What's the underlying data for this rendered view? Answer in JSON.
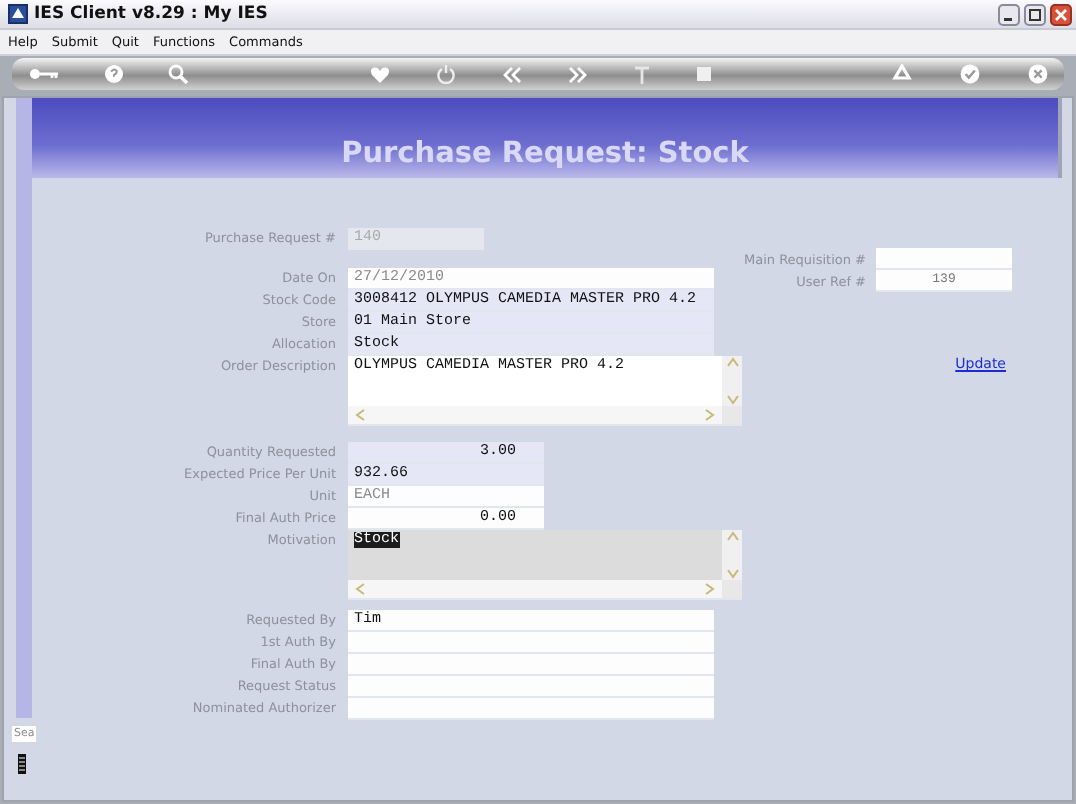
{
  "window": {
    "title": "IES Client v8.29 : My IES"
  },
  "menu": [
    "Help",
    "Submit",
    "Quit",
    "Functions",
    "Commands"
  ],
  "page_title": "Purchase Request: Stock",
  "request_number": {
    "label": "Purchase Request #",
    "value": "140"
  },
  "references": [
    {
      "label": "Main Requisition #"
    },
    {
      "label": "User Ref #",
      "value": "139"
    }
  ],
  "update_link": "Update",
  "detail_fields": [
    {
      "label": "Date On",
      "value": "27/12/2010",
      "kind": "line",
      "required": false,
      "disabled": true
    },
    {
      "label": "Stock Code",
      "value": "3008412 OLYMPUS CAMEDIA MASTER PRO 4.2",
      "kind": "line",
      "required": true,
      "disabled": false
    },
    {
      "label": "Store",
      "value": "01 Main Store",
      "kind": "line",
      "required": true,
      "disabled": false
    },
    {
      "label": "Allocation",
      "value": "Stock",
      "kind": "line",
      "required": true,
      "disabled": false
    },
    {
      "label": "Order Description",
      "value": "OLYMPUS CAMEDIA MASTER PRO 4.2",
      "kind": "memo",
      "required": false,
      "disabled": false
    }
  ],
  "amount_fields": [
    {
      "label": "Quantity Requested",
      "value": "3.00",
      "kind": "number",
      "required": true,
      "disabled": false
    },
    {
      "label": "Expected Price Per Unit",
      "value": "932.66",
      "kind": "line",
      "required": true,
      "disabled": false
    },
    {
      "label": "Unit",
      "value": "EACH",
      "kind": "line",
      "required": false,
      "disabled": true
    },
    {
      "label": "Final Auth Price",
      "value": "0.00",
      "kind": "number",
      "required": false,
      "disabled": false
    },
    {
      "label": "Motivation",
      "value": "Stock",
      "kind": "memo",
      "required": false,
      "disabled": true
    }
  ],
  "approval_fields": [
    {
      "label": "Requested By",
      "value": "Tim"
    },
    {
      "label": "1st Auth By"
    },
    {
      "label": "Final Auth By"
    },
    {
      "label": "Request Status"
    },
    {
      "label": "Nominated Authorizer"
    }
  ],
  "side_tab": "Sea"
}
